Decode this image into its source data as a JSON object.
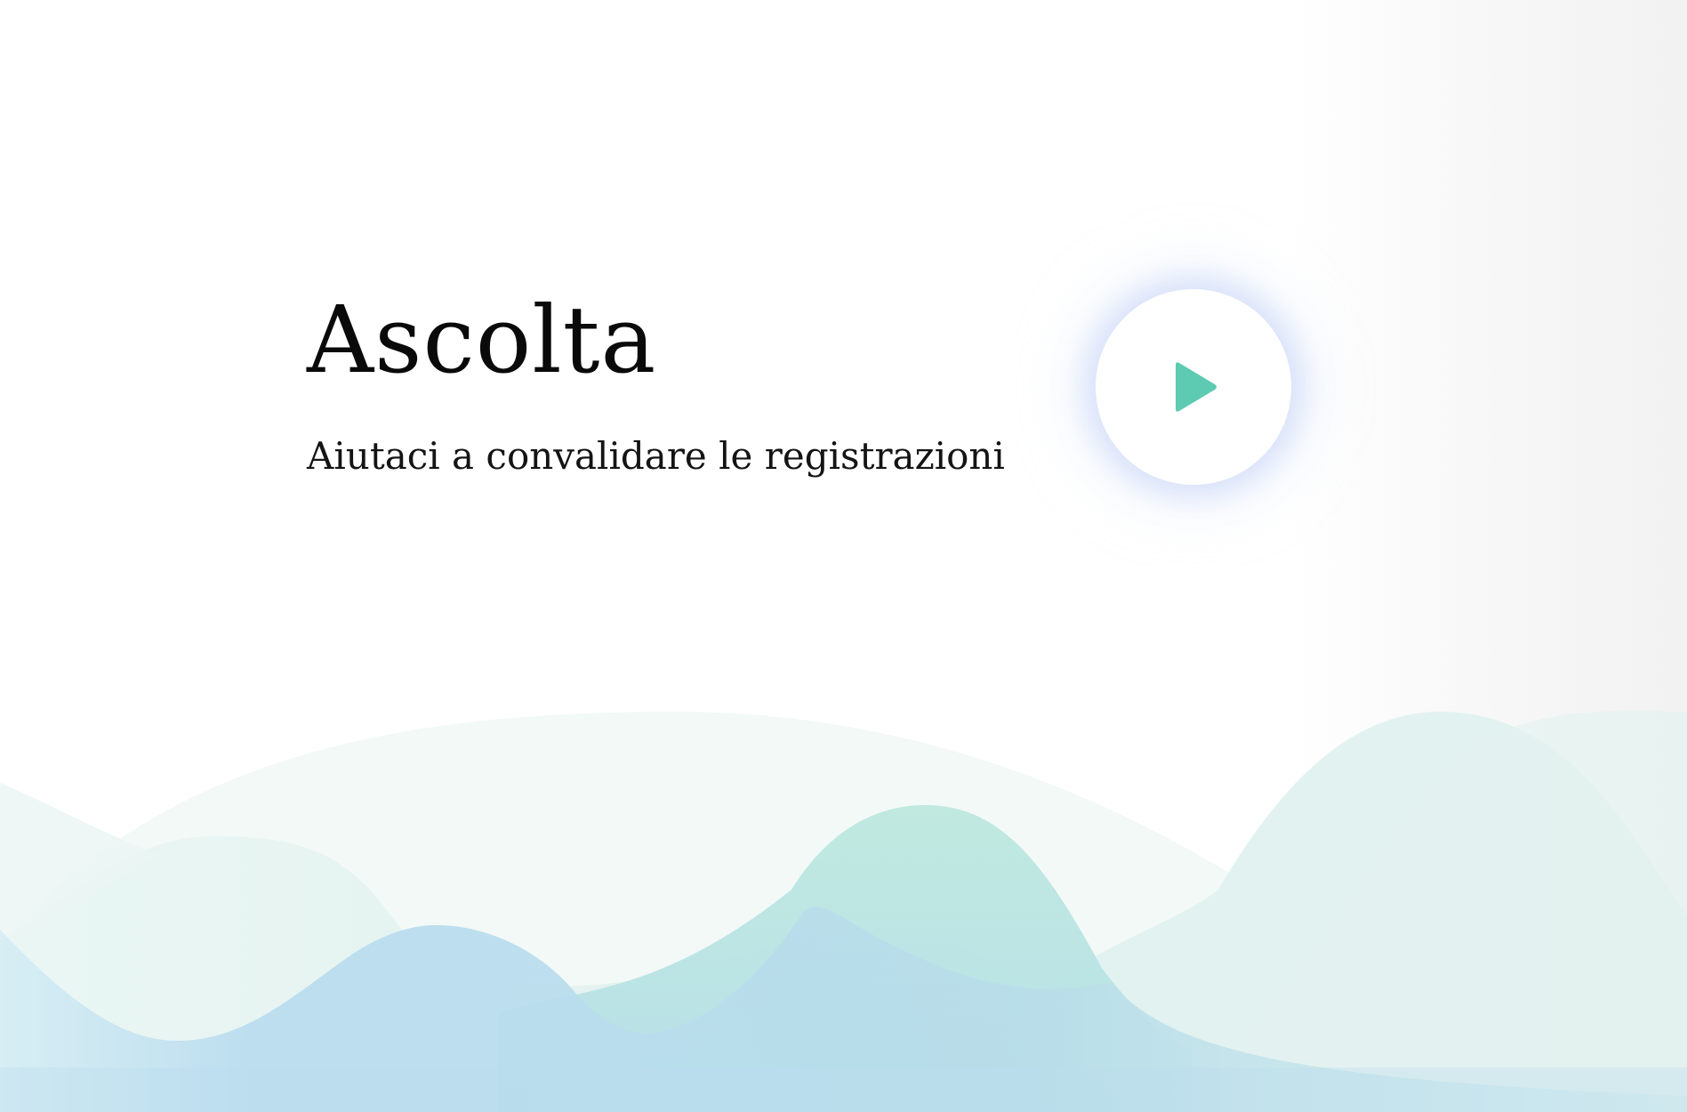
{
  "hero": {
    "title": "Ascolta",
    "subtitle": "Aiutaci a convalidare le registrazioni"
  },
  "play_button": {
    "icon": "play-icon",
    "icon_color": "#5ccbb2"
  },
  "colors": {
    "wave_teal": "#b6e6dc",
    "wave_blue": "#b7dcef",
    "wave_pale": "#eef7f5"
  }
}
